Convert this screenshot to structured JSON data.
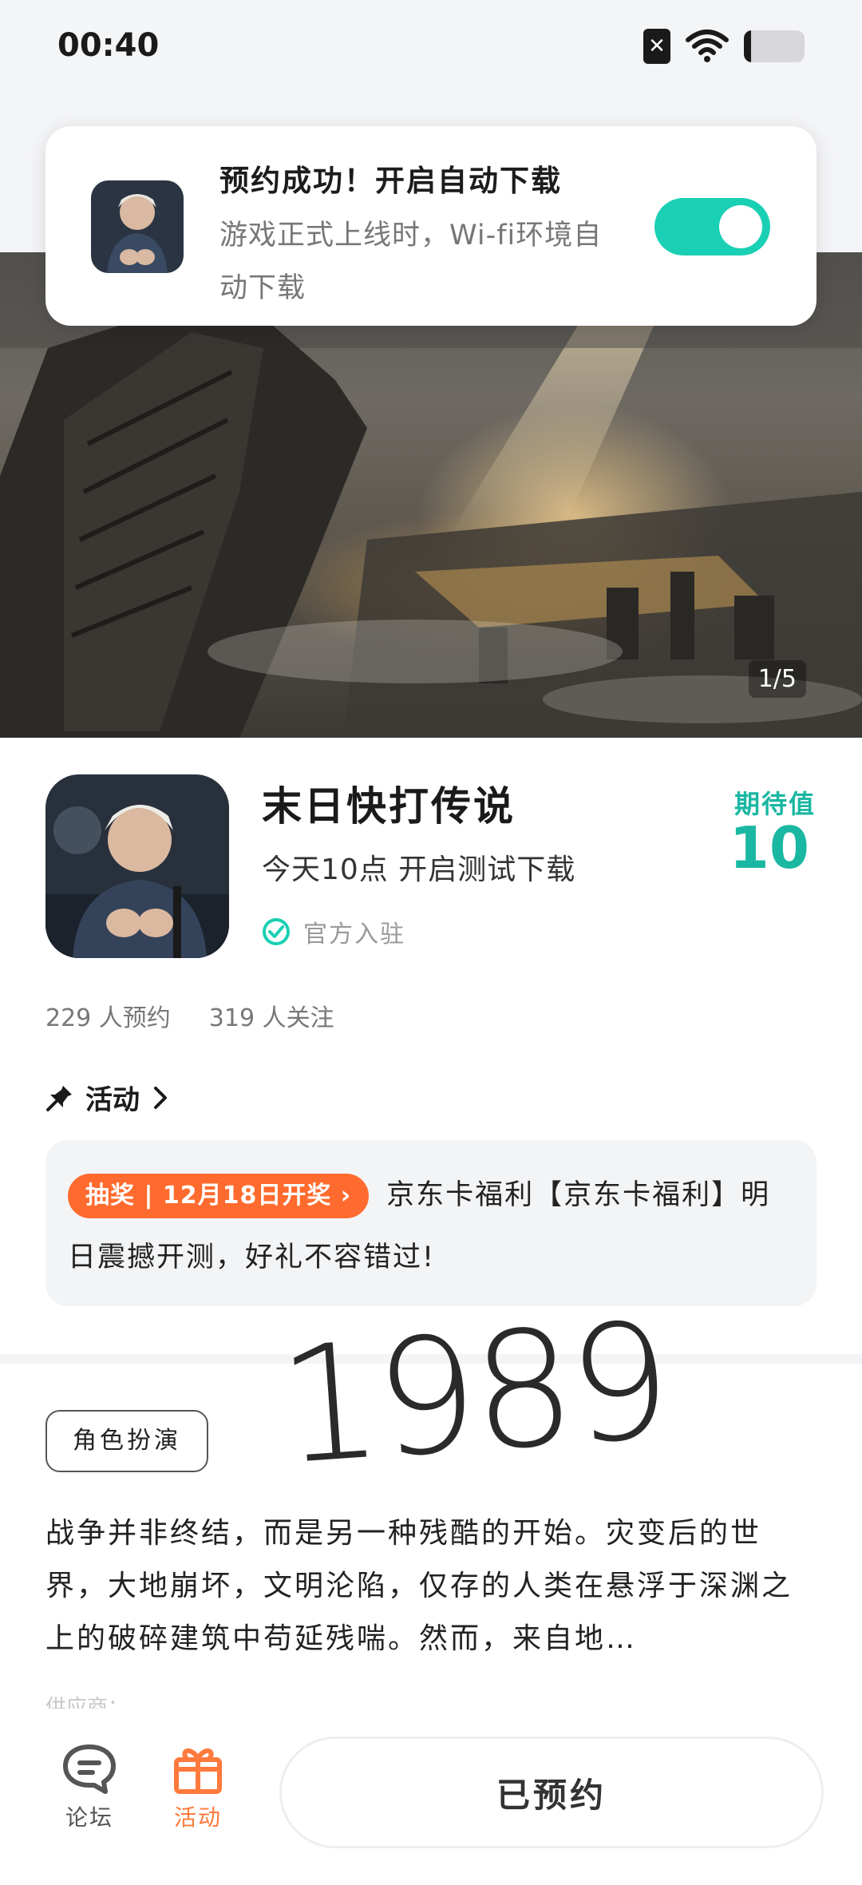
{
  "status_bar": {
    "time": "00:40",
    "battery_level": 0.12
  },
  "notification": {
    "title": "预约成功！开启自动下载",
    "description": "游戏正式上线时，Wi-fi环境自动下载",
    "toggle_on": true
  },
  "hero": {
    "counter": "1/5"
  },
  "game": {
    "name": "末日快打传说",
    "subtitle": "今天10点 开启测试下载",
    "official_label": "官方入驻",
    "expect_label": "期待值",
    "expect_value": "10",
    "reservations": "229 人预约",
    "followers": "319 人关注"
  },
  "activity": {
    "section_label": "活动",
    "tag": "抽奖 | 12月18日开奖 ›",
    "text": "京东卡福利【京东卡福利】明日震撼开测，好礼不容错过!"
  },
  "year_stamp": "1989",
  "genre_tag": "角色扮演",
  "description": "战争并非终结，而是另一种残酷的开始。灾变后的世界，大地崩坏，文明沦陷，仅存的人类在悬浮于深渊之上的破碎建筑中苟延残喘。然而，来自地…",
  "description_fade": "供应商：…",
  "bottom_nav": {
    "forum_label": "论坛",
    "activity_label": "活动",
    "reserved_label": "已预约"
  },
  "colors": {
    "accent": "#1ad0b4",
    "orange": "#ff6b2e"
  }
}
